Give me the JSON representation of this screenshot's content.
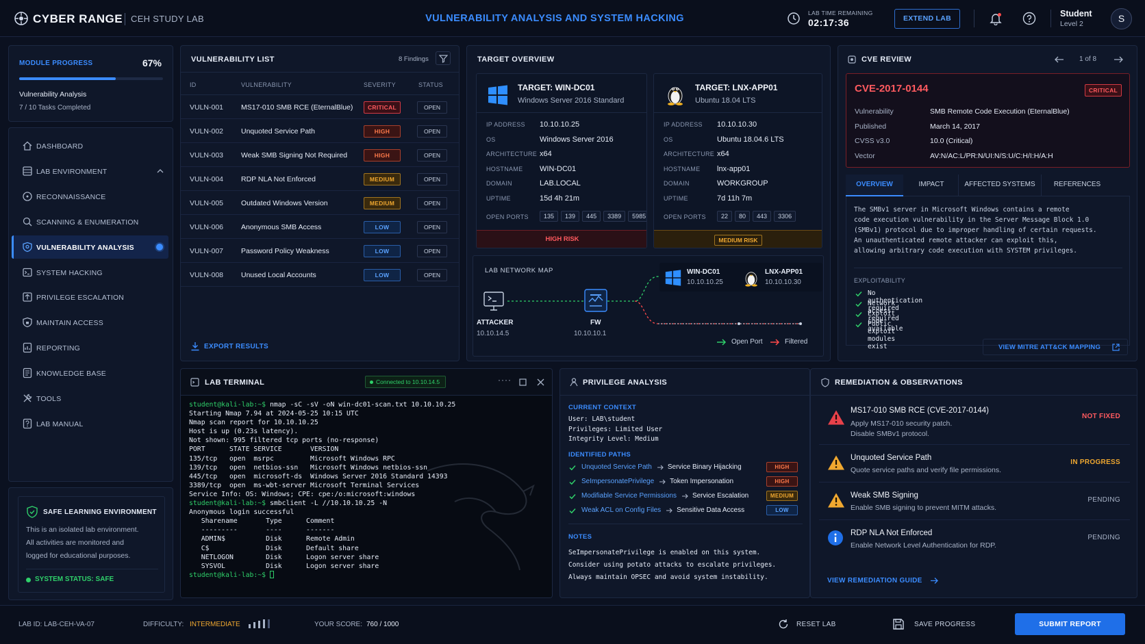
{
  "header": {
    "brand": "CYBER RANGE",
    "subtitle": "CEH STUDY LAB",
    "title": "VULNERABILITY ANALYSIS AND SYSTEM HACKING",
    "timer_label": "LAB TIME REMAINING",
    "timer_value": "02:17:36",
    "extend_label": "EXTEND LAB",
    "user_name": "Student",
    "user_level": "Level 2",
    "avatar_letter": "S"
  },
  "progress": {
    "label": "MODULE PROGRESS",
    "percent_text": "67%",
    "fraction": 0.67,
    "module": "Vulnerability Analysis",
    "tasks": "7 / 10 Tasks Completed"
  },
  "nav": [
    {
      "label": "DASHBOARD",
      "icon": "home-icon"
    },
    {
      "label": "LAB ENVIRONMENT",
      "icon": "server-icon"
    },
    {
      "label": "RECONNAISSANCE",
      "icon": "compass-icon"
    },
    {
      "label": "SCANNING & ENUMERATION",
      "icon": "scan-icon"
    },
    {
      "label": "VULNERABILITY ANALYSIS",
      "icon": "shield-icon"
    },
    {
      "label": "SYSTEM HACKING",
      "icon": "terminal-icon"
    },
    {
      "label": "PRIVILEGE ESCALATION",
      "icon": "arrow-up-icon"
    },
    {
      "label": "MAINTAIN ACCESS",
      "icon": "lock-icon"
    },
    {
      "label": "REPORTING",
      "icon": "report-icon"
    },
    {
      "label": "KNOWLEDGE BASE",
      "icon": "book-icon"
    },
    {
      "label": "TOOLS",
      "icon": "tools-icon"
    },
    {
      "label": "LAB MANUAL",
      "icon": "manual-icon"
    }
  ],
  "safe": {
    "title": "SAFE LEARNING ENVIRONMENT",
    "line1": "This is an isolated lab environment.",
    "line2": "All activities are monitored and",
    "line3": "logged for educational purposes.",
    "status": "SYSTEM STATUS: SAFE"
  },
  "vuln_list": {
    "title": "VULNERABILITY LIST",
    "findings": "8 Findings",
    "headers": [
      "ID",
      "VULNERABILITY",
      "SEVERITY",
      "STATUS"
    ],
    "rows": [
      {
        "id": "VULN-001",
        "name": "MS17-010 SMB RCE (EternalBlue)",
        "severity": "CRITICAL",
        "sev_class": "critical",
        "status": "OPEN"
      },
      {
        "id": "VULN-002",
        "name": "Unquoted Service Path",
        "severity": "HIGH",
        "sev_class": "high",
        "status": "OPEN"
      },
      {
        "id": "VULN-003",
        "name": "Weak SMB Signing Not Required",
        "severity": "HIGH",
        "sev_class": "high",
        "status": "OPEN"
      },
      {
        "id": "VULN-004",
        "name": "RDP NLA Not Enforced",
        "severity": "MEDIUM",
        "sev_class": "medium",
        "status": "OPEN"
      },
      {
        "id": "VULN-005",
        "name": "Outdated Windows Version",
        "severity": "MEDIUM",
        "sev_class": "medium",
        "status": "OPEN"
      },
      {
        "id": "VULN-006",
        "name": "Anonymous SMB Access",
        "severity": "LOW",
        "sev_class": "low",
        "status": "OPEN"
      },
      {
        "id": "VULN-007",
        "name": "Password Policy Weakness",
        "severity": "LOW",
        "sev_class": "low",
        "status": "OPEN"
      },
      {
        "id": "VULN-008",
        "name": "Unused Local Accounts",
        "severity": "LOW",
        "sev_class": "low",
        "status": "OPEN"
      }
    ],
    "export": "EXPORT RESULTS"
  },
  "targets": {
    "title": "TARGET OVERVIEW",
    "field_labels": [
      "IP ADDRESS",
      "OS",
      "ARCHITECTURE",
      "HOSTNAME",
      "DOMAIN",
      "UPTIME"
    ],
    "ports_label": "OPEN PORTS",
    "win": {
      "name": "TARGET: WIN-DC01",
      "os_full": "Windows Server 2016 Standard",
      "values": [
        "10.10.10.25",
        "Windows Server 2016",
        "x64",
        "WIN-DC01",
        "LAB.LOCAL",
        "15d 4h 21m"
      ],
      "ports": [
        "135",
        "139",
        "445",
        "3389",
        "5985"
      ],
      "risk": "HIGH RISK"
    },
    "lnx": {
      "name": "TARGET: LNX-APP01",
      "os_full": "Ubuntu 18.04 LTS",
      "values": [
        "10.10.10.30",
        "Ubuntu 18.04.6 LTS",
        "x64",
        "lnx-app01",
        "WORKGROUP",
        "7d 11h 7m"
      ],
      "ports": [
        "22",
        "80",
        "443",
        "3306"
      ],
      "risk": "MEDIUM RISK"
    }
  },
  "netmap": {
    "title": "LAB NETWORK MAP",
    "attacker": "ATTACKER",
    "attacker_ip": "10.10.14.5",
    "fw": "FW",
    "fw_ip": "10.10.10.1",
    "win": "WIN-DC01",
    "win_ip": "10.10.10.25",
    "lnx": "LNX-APP01",
    "lnx_ip": "10.10.10.30",
    "legend_open": "Open Port",
    "legend_filtered": "Filtered"
  },
  "cve": {
    "title": "CVE REVIEW",
    "pager": "1 of 8",
    "id": "CVE-2017-0144",
    "badge": "CRITICAL",
    "fields": [
      {
        "k": "Vulnerability",
        "v": "SMB Remote Code Execution (EternalBlue)"
      },
      {
        "k": "Published",
        "v": "March 14, 2017"
      },
      {
        "k": "CVSS v3.0",
        "v": "10.0 (Critical)"
      },
      {
        "k": "Vector",
        "v": "AV:N/AC:L/PR:N/UI:N/S:U/C:H/I:H/A:H"
      }
    ],
    "tabs": [
      "OVERVIEW",
      "IMPACT",
      "AFFECTED SYSTEMS",
      "REFERENCES"
    ],
    "desc": [
      "The SMBv1 server in Microsoft Windows contains a remote",
      "code execution vulnerability in the Server Message Block 1.0",
      "(SMBv1) protocol due to improper handling of certain requests.",
      "An unauthenticated remote attacker can exploit this,",
      "allowing arbitrary code execution with SYSTEM privileges."
    ],
    "exp_title": "EXPLOITABILITY",
    "exp": [
      "No authentication required",
      "Network access required",
      "Exploit code available",
      "Public exploit modules exist"
    ],
    "mitre": "VIEW MITRE ATT&CK MAPPING"
  },
  "terminal": {
    "title": "LAB TERMINAL",
    "connected": "Connected to 10.10.14.5",
    "lines": [
      {
        "p": "student@kali-lab:~$ ",
        "t": "nmap -sC -sV -oN win-dc01-scan.txt 10.10.10.25"
      },
      {
        "p": "",
        "t": "Starting Nmap 7.94 at 2024-05-25 10:15 UTC"
      },
      {
        "p": "",
        "t": "Nmap scan report for 10.10.10.25"
      },
      {
        "p": "",
        "t": "Host is up (0.23s latency)."
      },
      {
        "p": "",
        "t": "Not shown: 995 filtered tcp ports (no-response)"
      },
      {
        "p": "",
        "t": "PORT      STATE SERVICE       VERSION"
      },
      {
        "p": "",
        "t": "135/tcp   open  msrpc         Microsoft Windows RPC"
      },
      {
        "p": "",
        "t": "139/tcp   open  netbios-ssn   Microsoft Windows netbios-ssn"
      },
      {
        "p": "",
        "t": "445/tcp   open  microsoft-ds  Windows Server 2016 Standard 14393"
      },
      {
        "p": "",
        "t": "3389/tcp  open  ms-wbt-server Microsoft Terminal Services"
      },
      {
        "p": "",
        "t": "Service Info: OS: Windows; CPE: cpe:/o:microsoft:windows"
      },
      {
        "p": "student@kali-lab:~$ ",
        "t": "smbclient -L //10.10.10.25 -N"
      },
      {
        "p": "",
        "t": "Anonymous login successful"
      },
      {
        "p": "",
        "t": "   Sharename       Type      Comment"
      },
      {
        "p": "",
        "t": "   ---------       ----      -------"
      },
      {
        "p": "",
        "t": "   ADMIN$          Disk      Remote Admin"
      },
      {
        "p": "",
        "t": "   C$              Disk      Default share"
      },
      {
        "p": "",
        "t": "   NETLOGON        Disk      Logon server share"
      },
      {
        "p": "",
        "t": "   SYSVOL          Disk      Logon server share"
      },
      {
        "p": "student@kali-lab:~$ ",
        "t": ""
      }
    ]
  },
  "priv": {
    "title": "PRIVILEGE ANALYSIS",
    "context_title": "CURRENT CONTEXT",
    "context": [
      "User: LAB\\student",
      "Privileges: Limited User",
      "Integrity Level: Medium"
    ],
    "paths_title": "IDENTIFIED PATHS",
    "paths": [
      {
        "from": "Unquoted Service Path",
        "to": "Service Binary Hijacking",
        "sev": "HIGH",
        "cls": "high"
      },
      {
        "from": "SeImpersonatePrivilege",
        "to": "Token Impersonation",
        "sev": "HIGH",
        "cls": "high"
      },
      {
        "from": "Modifiable Service Permissions",
        "to": "Service Escalation",
        "sev": "MEDIUM",
        "cls": "medium"
      },
      {
        "from": "Weak ACL on Config Files",
        "to": "Sensitive Data Access",
        "sev": "LOW",
        "cls": "low"
      }
    ],
    "notes_title": "NOTES",
    "notes": [
      "SeImpersonatePrivilege is enabled on this system.",
      "Consider using potato attacks to escalate privileges.",
      "Always maintain OPSEC and avoid system instability."
    ]
  },
  "remediation": {
    "title": "REMEDIATION & OBSERVATIONS",
    "items": [
      {
        "title": "MS17-010 SMB RCE (CVE-2017-0144)",
        "desc": [
          "Apply MS17-010 security patch.",
          "Disable SMBv1 protocol."
        ],
        "status": "NOT FIXED",
        "color": "#ff5a5f",
        "icon": "warning-red"
      },
      {
        "title": "Unquoted Service Path",
        "desc": [
          "Quote service paths and verify file permissions."
        ],
        "status": "IN PROGRESS",
        "color": "#f0a830",
        "icon": "warning-amber"
      },
      {
        "title": "Weak SMB Signing",
        "desc": [
          "Enable SMB signing to prevent MITM attacks."
        ],
        "status": "PENDING",
        "color": "#a8b3c7",
        "icon": "warning-amber"
      },
      {
        "title": "RDP NLA Not Enforced",
        "desc": [
          "Enable Network Level Authentication for RDP."
        ],
        "status": "PENDING",
        "color": "#a8b3c7",
        "icon": "info-blue"
      }
    ],
    "guide": "VIEW REMEDIATION GUIDE"
  },
  "footer": {
    "lab_id": "LAB ID: LAB-CEH-VA-07",
    "difficulty_label": "DIFFICULTY:",
    "difficulty": "INTERMEDIATE",
    "score_label": "YOUR SCORE:",
    "score": "760 / 1000",
    "reset": "RESET LAB",
    "save": "SAVE PROGRESS",
    "submit": "SUBMIT REPORT"
  },
  "colors": {
    "accent": "#3b8cff",
    "critical": "#ff5a5f",
    "medium": "#f0a830",
    "ok": "#2fd06a"
  }
}
